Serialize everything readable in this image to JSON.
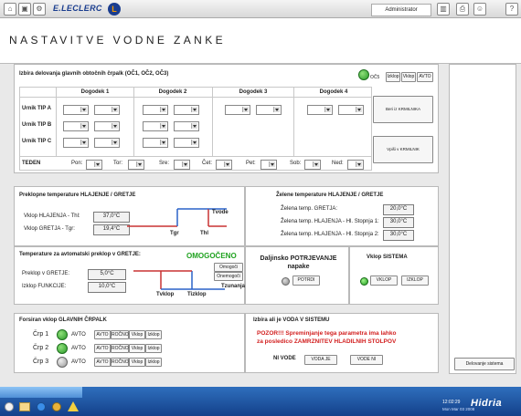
{
  "topbar": {
    "brand": "E.LECLERC",
    "brand_mark": "L",
    "user": "Administrator"
  },
  "page_title": "NASTAVITVE VODNE ZANKE",
  "pumps_section": {
    "title": "Izbira delovanja glavnih obtočnih črpalk (OČ1, OČ2, OČ3)",
    "badge": "OČ5",
    "buttons": [
      "Izklop",
      "Vklop",
      "AVTO"
    ],
    "events": [
      "Dogodek 1",
      "Dogodek 2",
      "Dogodek 3",
      "Dogodek 4"
    ],
    "rows": [
      "Urnik TIP A",
      "Urnik TIP B",
      "Urnik TIP C"
    ],
    "week_label": "TEDEN",
    "days": [
      "Pon:",
      "Tor:",
      "Sre:",
      "Čet:",
      "Pet:",
      "Sob:",
      "Ned:"
    ],
    "read_btn": "Beri iz KRMILNIKA",
    "write_btn": "Vpiši v KRMILNIK"
  },
  "switch_temps": {
    "title": "Preklopne temperature HLAJENJE / GRETJE",
    "rows": [
      {
        "label": "Vklop HLAJENJA - Thl:",
        "value": "37,0°C"
      },
      {
        "label": "Vklop GRETJA - Tgr:",
        "value": "19,4°C"
      }
    ],
    "tvode": "Tvode",
    "tgr": "Tgr",
    "thl": "Thl"
  },
  "desired_temps": {
    "title": "Želene temperature HLAJENJE / GRETJE",
    "rows": [
      {
        "label": "Želena temp. GRETJA:",
        "value": "20,0°C"
      },
      {
        "label": "Želena temp. HLAJENJA - Hl. Stopnja 1:",
        "value": "30,0°C"
      },
      {
        "label": "Želena temp. HLAJENJA - Hl. Stopnja 2:",
        "value": "30,0°C"
      }
    ]
  },
  "auto_switch": {
    "title": "Temperature za avtomatski preklop v GRETJE:",
    "status": "OMOGOČENO",
    "enable_btn": "Omogoči",
    "disable_btn": "Onemogoči",
    "rows": [
      {
        "label": "Preklop v GRETJE:",
        "value": "5,0°C"
      },
      {
        "label": "Izklop FUNKCIJE:",
        "value": "10,0°C"
      }
    ],
    "tvklop": "Tvklop",
    "tizklop": "Tizklop",
    "tzunanja": "Tzunanja"
  },
  "remote": {
    "title": "Daljinsko POTRJEVANJE napake",
    "button": "POTRDI"
  },
  "system": {
    "title": "Vklop SISTEMA",
    "on": "VKLOP",
    "off": "IZKLOP"
  },
  "forced": {
    "title": "Forsiran vklop GLAVNIH ČRPALK",
    "pumps": [
      {
        "label": "Črp 1",
        "mode": "AVTO"
      },
      {
        "label": "Črp 2",
        "mode": "AVTO"
      },
      {
        "label": "Črp 3",
        "mode": "AVTO"
      }
    ],
    "buttons": [
      "AVTO",
      "ROČNO",
      "Vklop",
      "Izklop"
    ]
  },
  "water": {
    "title": "Izbira ali je VODA V SISTEMU",
    "warning1": "POZOR!!! Spreminjanje tega parametra ima lahko",
    "warning2": "za posledico ZAMRZNITEV HLADILNIH STOLPOV",
    "no_water": "NI VODE",
    "btn1": "VODA JE",
    "btn2": "VODE NI"
  },
  "side": {
    "button": "Delovanje sistema"
  },
  "taskbar": {
    "brand": "Hidria",
    "time": "12:02:29",
    "date": "Mon Mar 03 2008"
  },
  "colors": {
    "accent": "#1a3d8f",
    "green": "#1fa21f",
    "red": "#d21e1e"
  }
}
